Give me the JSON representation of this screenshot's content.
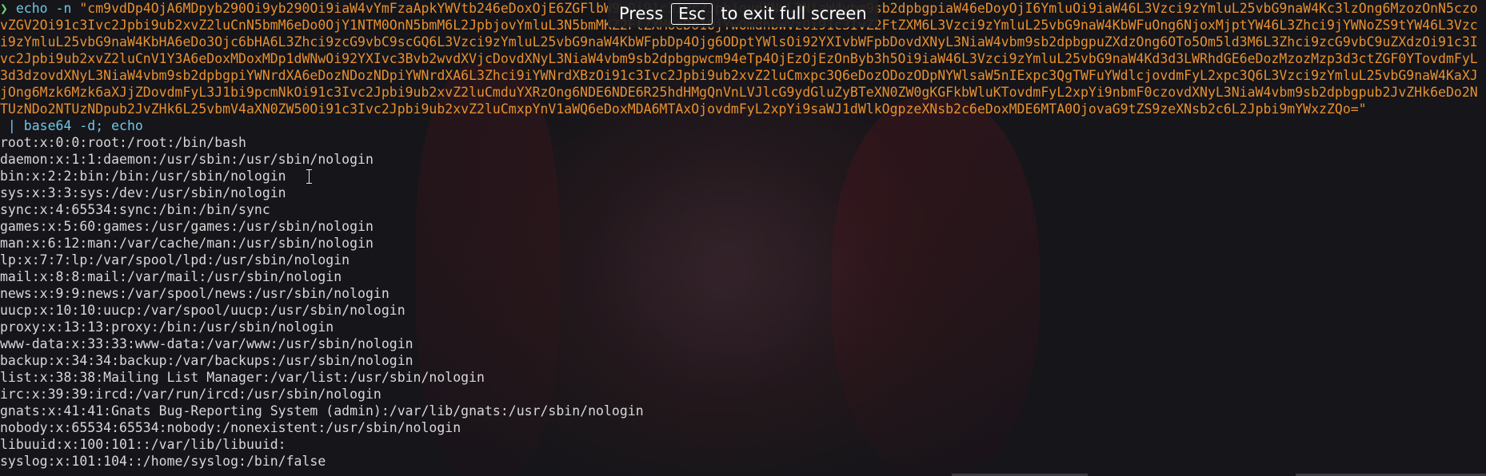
{
  "prompt_symbol": "❯",
  "command": {
    "name": "echo",
    "flag": " -n ",
    "payload": "\"cm9vdDp4OjA6MDpyb290Oi9yb290Oi9iaW4vYmFzaApkYWVtb246eDoxOjE6ZGFlbW9uOi91c3Ivc2JpbjovdXNyL3NiaW4vbm9sb2dpbgpiaW46eDoyOjI6YmluOi9iaW46L3Vzci9zYmluL25vbG9naW4Kc3lzOng6MzozOnN5czovZGV2Oi91c3Ivc2Jpbi9ub2xvZ2luCnN5bmM6eDo0OjY1NTM0OnN5bmM6L2JpbjovYmluL3N5bmMKZ2FtZXM6eDo1OjYwOmdhbWVzOi91c3IvZ2FtZXM6L3Vzci9zYmluL25vbG9naW4KbWFuOng6NjoxMjptYW46L3Zhci9jYWNoZS9tYW46L3Vzci9zYmluL25vbG9naW4KbHA6eDo3Ojc6bHA6L3Zhci9zcG9vbC9scGQ6L3Vzci9zYmluL25vbG9naW4KbWFpbDp4Ojg6ODptYWlsOi92YXIvbWFpbDovdXNyL3NiaW4vbm9sb2dpbgpuZXdzOng6OTo5Om5ld3M6L3Zhci9zcG9vbC9uZXdzOi91c3Ivc2Jpbi9ub2xvZ2luCnV1Y3A6eDoxMDoxMDp1dWNwOi92YXIvc3Bvb2wvdXVjcDovdXNyL3NiaW4vbm9sb2dpbgpwcm94eTp4OjEzOjEzOnByb3h5Oi9iaW46L3Vzci9zYmluL25vbG9naW4Kd3d3LWRhdGE6eDozMzozMzp3d3ctZGF0YTovdmFyL3d3dzovdXNyL3NiaW4vbm9sb2dpbgpiYWNrdXA6eDozNDozNDpiYWNrdXA6L3Zhci9iYWNrdXBzOi91c3Ivc2Jpbi9ub2xvZ2luCmxpc3Q6eDozODozODpNYWlsaW5nIExpc3QgTWFuYWdlcjovdmFyL2xpc3Q6L3Vzci9zYmluL25vbG9naW4KaXJjOng6Mzk6Mzk6aXJjZDovdmFyL3J1bi9pcmNkOi91c3Ivc2Jpbi9ub2xvZ2luCmduYXRzOng6NDE6NDE6R25hdHMgQnVnLVJlcG9ydGluZyBTeXN0ZW0gKGFkbWluKTovdmFyL2xpYi9nbmF0czovdXNyL3NiaW4vbm9sb2dpbgpub2JvZHk6eDo2NTUzNDo2NTUzNDpub2JvZHk6L25vbmV4aXN0ZW50Oi91c3Ivc2Jpbi9ub2xvZ2luCmxpYnV1aWQ6eDoxMDA6MTAxOjovdmFyL2xpYi9saWJ1dWlkOgpzeXNsb2c6eDoxMDE6MTA0OjovaG9tZS9zeXNsb2c6L2Jpbi9mYWxzZQo=\"",
    "pipe": " | base64 -d; echo"
  },
  "output_lines": [
    "root:x:0:0:root:/root:/bin/bash",
    "daemon:x:1:1:daemon:/usr/sbin:/usr/sbin/nologin",
    "bin:x:2:2:bin:/bin:/usr/sbin/nologin",
    "sys:x:3:3:sys:/dev:/usr/sbin/nologin",
    "sync:x:4:65534:sync:/bin:/bin/sync",
    "games:x:5:60:games:/usr/games:/usr/sbin/nologin",
    "man:x:6:12:man:/var/cache/man:/usr/sbin/nologin",
    "lp:x:7:7:lp:/var/spool/lpd:/usr/sbin/nologin",
    "mail:x:8:8:mail:/var/mail:/usr/sbin/nologin",
    "news:x:9:9:news:/var/spool/news:/usr/sbin/nologin",
    "uucp:x:10:10:uucp:/var/spool/uucp:/usr/sbin/nologin",
    "proxy:x:13:13:proxy:/bin:/usr/sbin/nologin",
    "www-data:x:33:33:www-data:/var/www:/usr/sbin/nologin",
    "backup:x:34:34:backup:/var/backups:/usr/sbin/nologin",
    "list:x:38:38:Mailing List Manager:/var/list:/usr/sbin/nologin",
    "irc:x:39:39:ircd:/var/run/ircd:/usr/sbin/nologin",
    "gnats:x:41:41:Gnats Bug-Reporting System (admin):/var/lib/gnats:/usr/sbin/nologin",
    "nobody:x:65534:65534:nobody:/nonexistent:/usr/sbin/nologin",
    "libuuid:x:100:101::/var/lib/libuuid:",
    "syslog:x:101:104::/home/syslog:/bin/false"
  ],
  "fullscreen_banner": {
    "press": "Press",
    "key": "Esc",
    "suffix": "to exit full screen"
  },
  "colors": {
    "prompt": "#6ed36e",
    "command": "#6ec8e6",
    "string": "#e8902e",
    "output": "#d8d8d8",
    "background": "#15151a"
  }
}
